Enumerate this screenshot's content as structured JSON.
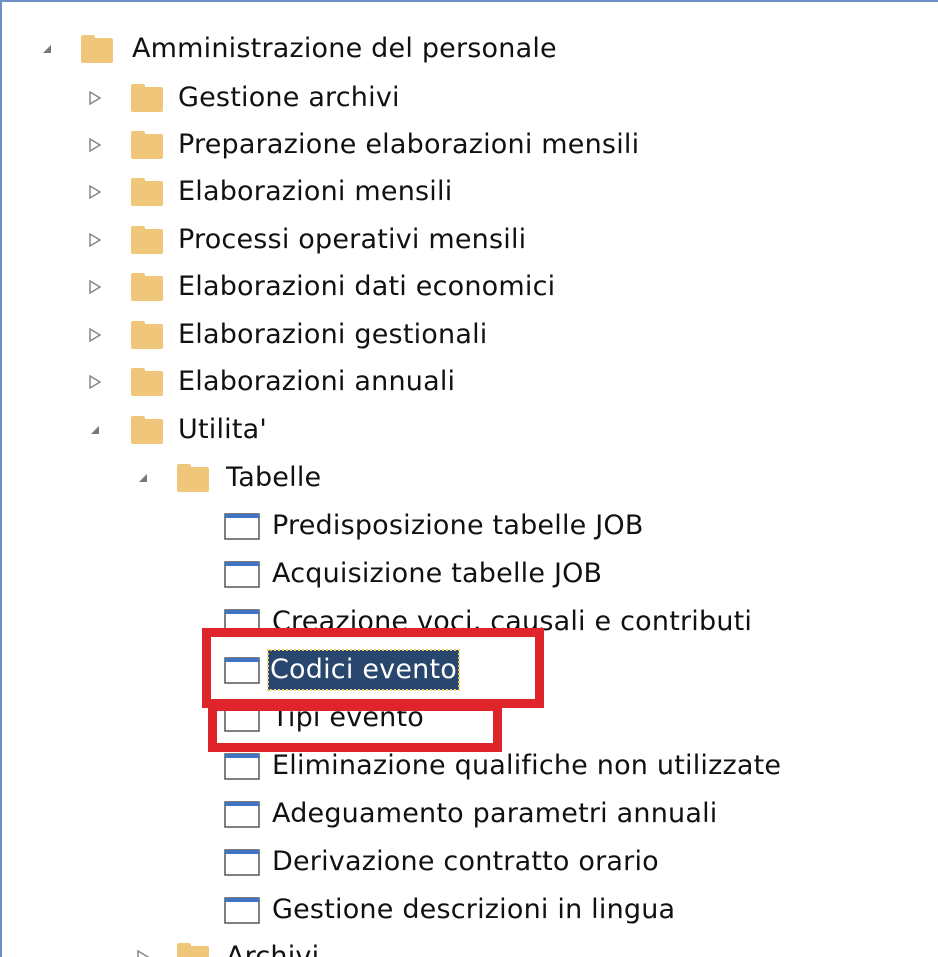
{
  "tree": {
    "root": {
      "label": "Amministrazione del personale",
      "expanded": true,
      "children": [
        {
          "label": "Gestione archivi",
          "expanded": false
        },
        {
          "label": "Preparazione elaborazioni mensili",
          "expanded": false
        },
        {
          "label": "Elaborazioni mensili",
          "expanded": false
        },
        {
          "label": "Processi operativi mensili",
          "expanded": false
        },
        {
          "label": "Elaborazioni dati economici",
          "expanded": false
        },
        {
          "label": "Elaborazioni gestionali",
          "expanded": false
        },
        {
          "label": "Elaborazioni annuali",
          "expanded": false
        },
        {
          "label": "Utilita'",
          "expanded": true
        }
      ]
    },
    "utilita": {
      "tabelle": {
        "label": "Tabelle",
        "expanded": true,
        "items": [
          {
            "label": "Predisposizione tabelle JOB"
          },
          {
            "label": "Acquisizione tabelle JOB"
          },
          {
            "label": "Creazione voci, causali e contributi"
          },
          {
            "label": "Codici evento",
            "selected": true
          },
          {
            "label": "Tipi evento"
          },
          {
            "label": "Eliminazione qualifiche non utilizzate"
          },
          {
            "label": "Adeguamento parametri annuali"
          },
          {
            "label": "Derivazione contratto orario"
          },
          {
            "label": "Gestione descrizioni in lingua"
          }
        ]
      },
      "archivi": {
        "label": "Archivi",
        "expanded": false
      }
    }
  },
  "colors": {
    "folder": "#f0c77a",
    "selection": "#28466e",
    "annotation": "#e0242b",
    "frame": "#6e8fc4"
  },
  "icons": {
    "expanded": "expanded-triangle-icon",
    "collapsed": "collapsed-triangle-icon",
    "folder": "folder-icon",
    "document": "window-document-icon"
  }
}
